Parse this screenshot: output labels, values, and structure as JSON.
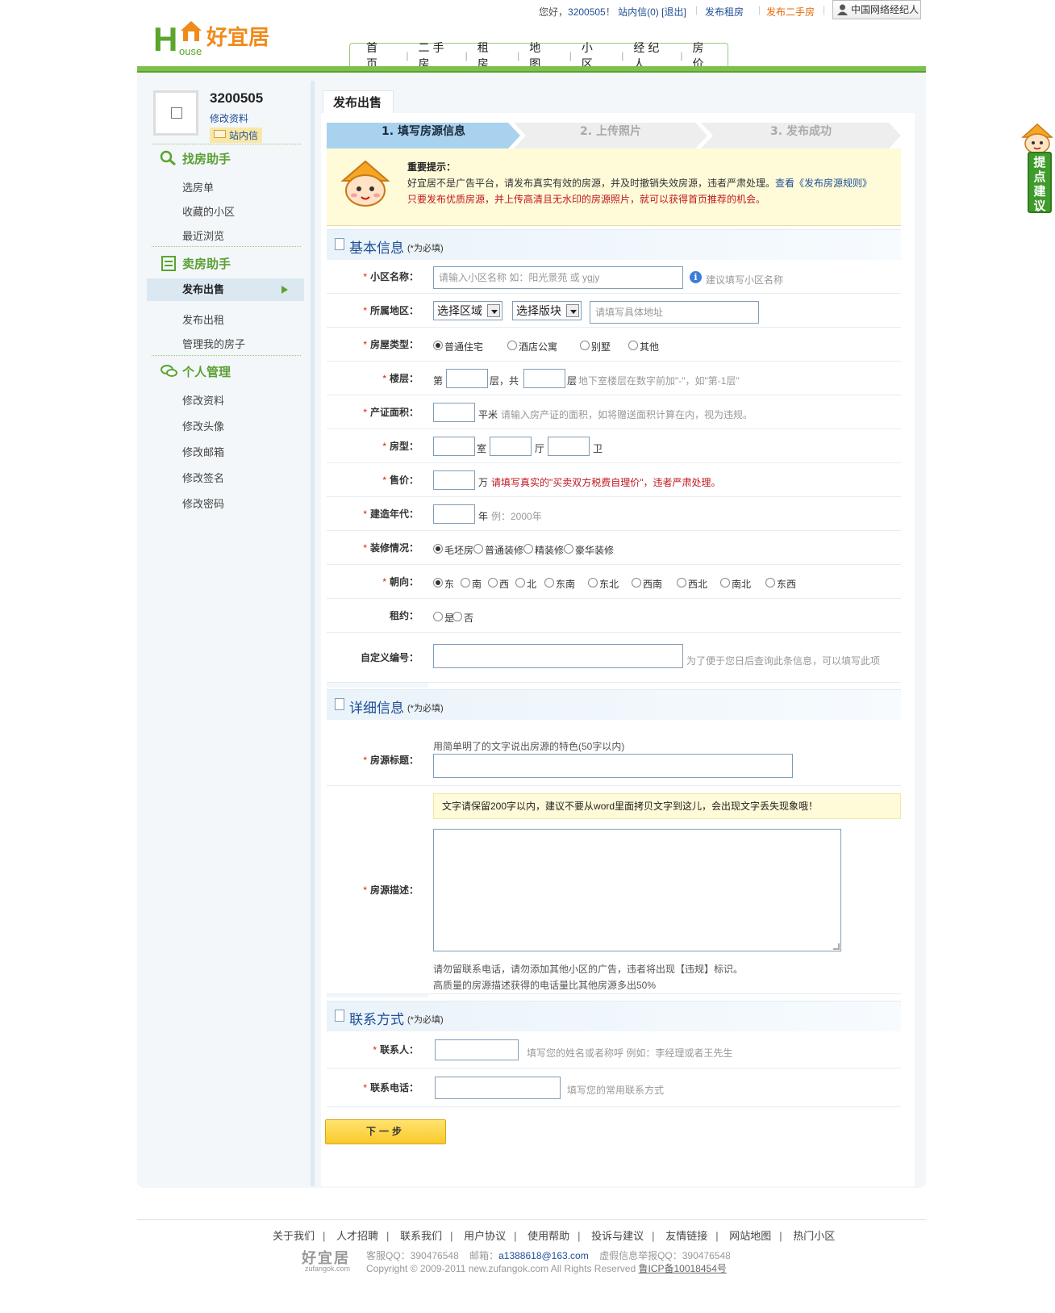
{
  "header": {
    "greeting": "您好，",
    "username": "3200505",
    "exclaim": "！",
    "inbox_link": "站内信(0)",
    "logout_link": "[退出]",
    "publish_rent": "发布租房",
    "publish_sale": "发布二手房",
    "agent_button": "中国网络经纪人"
  },
  "logo": {
    "h": "H",
    "ouse": "ouse",
    "cn": "好宜居"
  },
  "nav": [
    "首 页",
    "二手房",
    "租 房",
    "地 图",
    "小 区",
    "经纪人",
    "房 价"
  ],
  "sidebar": {
    "username": "3200505",
    "edit_profile": "修改资料",
    "inbox": "站内信",
    "groups": [
      {
        "title": "找房助手",
        "items": [
          "选房单",
          "收藏的小区",
          "最近浏览"
        ]
      },
      {
        "title": "卖房助手",
        "items": [
          "发布出售",
          "发布出租",
          "管理我的房子"
        ]
      },
      {
        "title": "个人管理",
        "items": [
          "修改资料",
          "修改头像",
          "修改邮箱",
          "修改签名",
          "修改密码"
        ]
      }
    ]
  },
  "tab": "发布出售",
  "steps": [
    "1. 填写房源信息",
    "2. 上传照片",
    "3. 发布成功"
  ],
  "notice": {
    "title": "重要提示：",
    "line1": "好宜居不是广告平台，请发布真实有效的房源，并及时撤销失效房源，违者严肃处理。",
    "line1_link": "查看《发布房源规则》",
    "line2": "只要发布优质房源，并上传高清且无水印的房源照片，就可以获得首页推荐的机会。"
  },
  "sections": {
    "basic": {
      "title": "基本信息",
      "req": "(*为必填)"
    },
    "detail": {
      "title": "详细信息",
      "req": "(*为必填)"
    },
    "contact": {
      "title": "联系方式",
      "req": "(*为必填)"
    }
  },
  "form": {
    "community": {
      "label": "小区名称：",
      "placeholder": "请输入小区名称 如：阳光景苑 或 ygjy",
      "hint": "建议填写小区名称"
    },
    "area": {
      "label": "所属地区：",
      "district": "选择区域",
      "block": "选择版块",
      "address_placeholder": "请填写具体地址"
    },
    "type": {
      "label": "房屋类型：",
      "options": [
        "普通住宅",
        "酒店公寓",
        "别墅",
        "其他"
      ],
      "selected": "普通住宅"
    },
    "floor": {
      "label": "楼层：",
      "pre": "第",
      "mid": "层，共",
      "post": "层",
      "hint": "地下室楼层在数字前加\"-\"，如\"第-1层\""
    },
    "size": {
      "label": "产证面积：",
      "unit": "平米",
      "hint": "请输入房产证的面积，如将赠送面积计算在内，视为违规。"
    },
    "layout": {
      "label": "房型：",
      "u1": "室",
      "u2": "厅",
      "u3": "卫"
    },
    "price": {
      "label": "售价：",
      "unit": "万",
      "hint": "请填写真实的\"买卖双方税费自理价\"，违者严肃处理。"
    },
    "year": {
      "label": "建造年代：",
      "unit": "年",
      "hint": "例：2000年"
    },
    "decoration": {
      "label": "装修情况：",
      "options": [
        "毛坯房",
        "普通装修",
        "精装修",
        "豪华装修"
      ],
      "selected": "毛坯房"
    },
    "orientation": {
      "label": "朝向：",
      "options": [
        "东",
        "南",
        "西",
        "北",
        "东南",
        "东北",
        "西南",
        "西北",
        "南北",
        "东西"
      ],
      "selected": "东"
    },
    "lease": {
      "label": "租约：",
      "options": [
        "是",
        "否"
      ]
    },
    "custom_id": {
      "label": "自定义编号：",
      "hint": "为了便于您日后查询此条信息，可以填写此项"
    },
    "listing_title": {
      "label": "房源标题：",
      "hint": "用简单明了的文字说出房源的特色(50字以内)"
    },
    "description": {
      "label": "房源描述：",
      "tip": "文字请保留200字以内，建议不要从word里面拷贝文字到这儿，会出现文字丢失现象哦！",
      "note1": "请勿留联系电话，请勿添加其他小区的广告，违者将出现【违规】标识。",
      "note2": "高质量的房源描述获得的电话量比其他房源多出50%"
    },
    "contact_name": {
      "label": "联系人：",
      "hint": "填写您的姓名或者称呼 例如：李经理或者王先生"
    },
    "contact_phone": {
      "label": "联系电话：",
      "hint": "填写您的常用联系方式"
    }
  },
  "next_button": "下一步",
  "footer": {
    "links": [
      "关于我们",
      "人才招聘",
      "联系我们",
      "用户协议",
      "使用帮助",
      "投诉与建议",
      "友情链接",
      "网站地图",
      "热门小区"
    ],
    "logo_cn": "好宜居",
    "logo_en": "zufangok.com",
    "qq_label": "客服QQ：",
    "qq": "390476548",
    "email_label": "邮箱：",
    "email": "a1388618@163.com",
    "report_label": "虚假信息举报QQ：",
    "report_qq": "390476548",
    "copyright": "Copyright © 2009-2011 new.zufangok.com All Rights Reserved",
    "icp": "鲁ICP备10018454号"
  },
  "float_widget": "提点建议",
  "colors": {
    "brand_green": "#5aa52c",
    "brand_orange": "#f08a1a",
    "link_blue": "#1f4e96",
    "warn_red": "#c0161c"
  }
}
